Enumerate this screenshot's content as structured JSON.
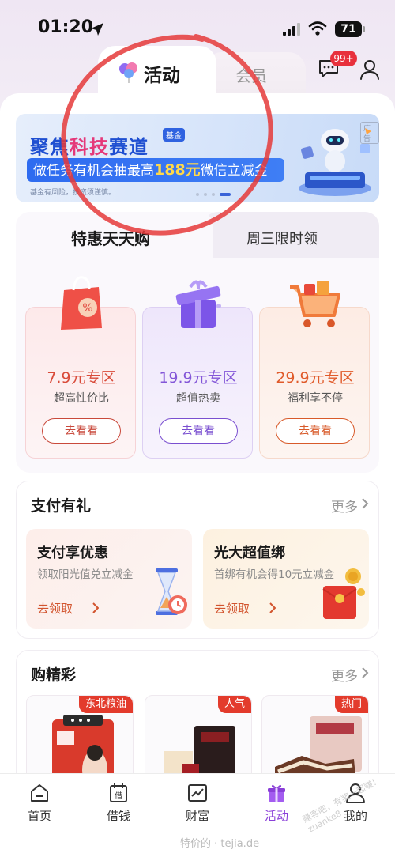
{
  "status_bar": {
    "time": "01:20",
    "battery": "71"
  },
  "header": {
    "tabs": [
      {
        "label": "活动",
        "active": true
      },
      {
        "label": "会员",
        "active": false
      }
    ],
    "message_badge": "99+",
    "icons": [
      "balloon-icon",
      "message-icon",
      "user-icon"
    ]
  },
  "banner": {
    "line1_a": "聚焦",
    "line1_b": "科技",
    "line1_c": "赛道",
    "fund_tag": "基金",
    "line2_a": "做任务有机会抽最高",
    "line2_amount": "188元",
    "line2_b": "微信立减金",
    "disclaimer": "基金有风险，投资须谨慎。",
    "ad_label": "广告"
  },
  "promo": {
    "tabs": [
      {
        "label": "特惠天天购",
        "active": true
      },
      {
        "label": "周三限时领",
        "active": false
      }
    ],
    "zones": [
      {
        "title": "7.9元专区",
        "subtitle": "超高性价比",
        "button": "去看看"
      },
      {
        "title": "19.9元专区",
        "subtitle": "超值热卖",
        "button": "去看看"
      },
      {
        "title": "29.9元专区",
        "subtitle": "福利享不停",
        "button": "去看看"
      }
    ]
  },
  "pay_section": {
    "title": "支付有礼",
    "more": "更多",
    "cards": [
      {
        "title": "支付享优惠",
        "subtitle": "领取阳光值兑立减金",
        "link": "去领取"
      },
      {
        "title": "光大超值绑",
        "subtitle": "首绑有机会得10元立减金",
        "link": "去领取"
      }
    ]
  },
  "shop_section": {
    "title": "购精彩",
    "more": "更多",
    "products": [
      {
        "tag": "东北粮油"
      },
      {
        "tag": "人气"
      },
      {
        "tag": "热门"
      }
    ]
  },
  "bottom_nav": {
    "items": [
      {
        "label": "首页",
        "icon": "home-icon",
        "active": false
      },
      {
        "label": "借钱",
        "icon": "loan-icon",
        "active": false
      },
      {
        "label": "财富",
        "icon": "wealth-icon",
        "active": false
      },
      {
        "label": "活动",
        "icon": "gift-icon",
        "active": true
      },
      {
        "label": "我的",
        "icon": "profile-icon",
        "active": false
      }
    ]
  },
  "watermark": {
    "text1": "特价的 · tejia.de",
    "text2": "赚客吧，有奖一起赚！zuanke8"
  },
  "colors": {
    "accent_purple": "#8a3fd8",
    "badge_red": "#e8303c",
    "banner_blue": "#1f4fd1"
  }
}
